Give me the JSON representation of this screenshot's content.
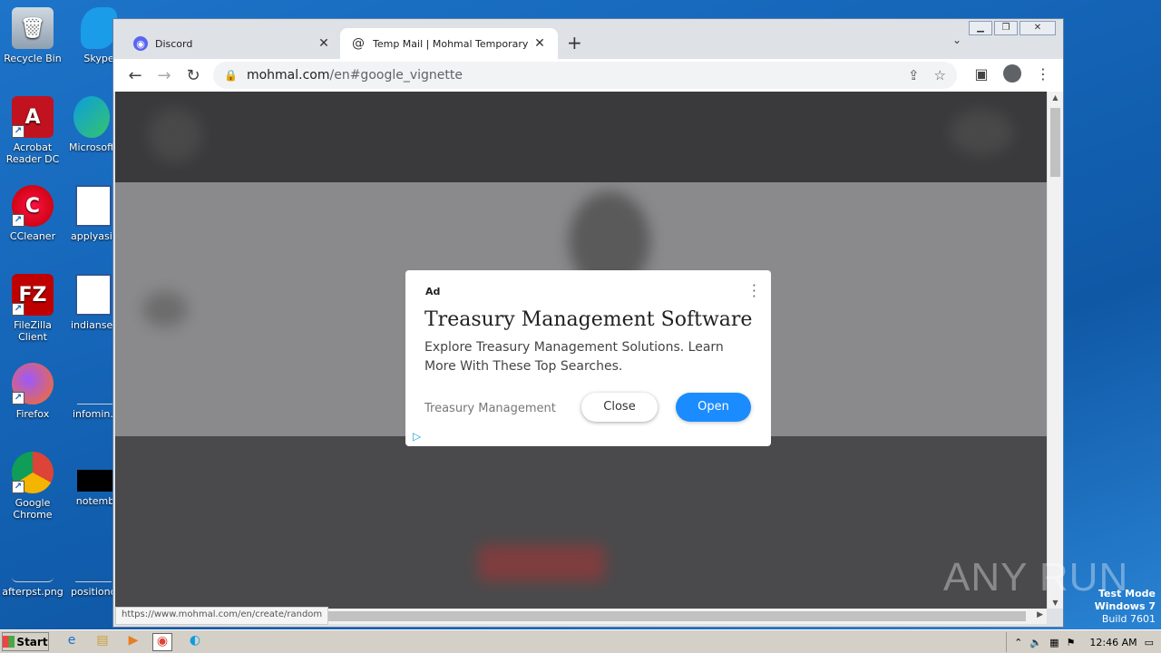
{
  "desktop": {
    "icons": [
      {
        "label": "Recycle Bin"
      },
      {
        "label": "Skype"
      },
      {
        "label": "Acrobat Reader DC"
      },
      {
        "label": "Microsoft"
      },
      {
        "label": "CCleaner"
      },
      {
        "label": "applyasia"
      },
      {
        "label": "FileZilla Client"
      },
      {
        "label": "indianset"
      },
      {
        "label": "Firefox"
      },
      {
        "label": "infomin.p"
      },
      {
        "label": "Google Chrome"
      },
      {
        "label": "notemb"
      },
      {
        "label": "afterpst.png"
      },
      {
        "label": "positiond"
      }
    ]
  },
  "browser": {
    "tabs": [
      {
        "title": "Discord",
        "icon": "discord-icon",
        "active": false
      },
      {
        "title": "Temp Mail | Mohmal Temporary Dispo",
        "icon": "at-sign-icon",
        "active": true
      }
    ],
    "url_host": "mohmal.com",
    "url_path": "/en#google_vignette",
    "status_url": "https://www.mohmal.com/en/create/random"
  },
  "ad": {
    "label": "Ad",
    "title": "Treasury Management Software",
    "description": "Explore Treasury Management Solutions. Learn More With These Top Searches.",
    "source": "Treasury Management",
    "close_label": "Close",
    "open_label": "Open"
  },
  "watermark": "ANY RUN",
  "system": {
    "test_mode": "Test Mode",
    "os": "Windows 7",
    "build": "Build 7601",
    "start_label": "Start",
    "clock": "12:46 AM"
  },
  "colors": {
    "accent": "#1a8cff",
    "desktop": "#1565b8"
  }
}
